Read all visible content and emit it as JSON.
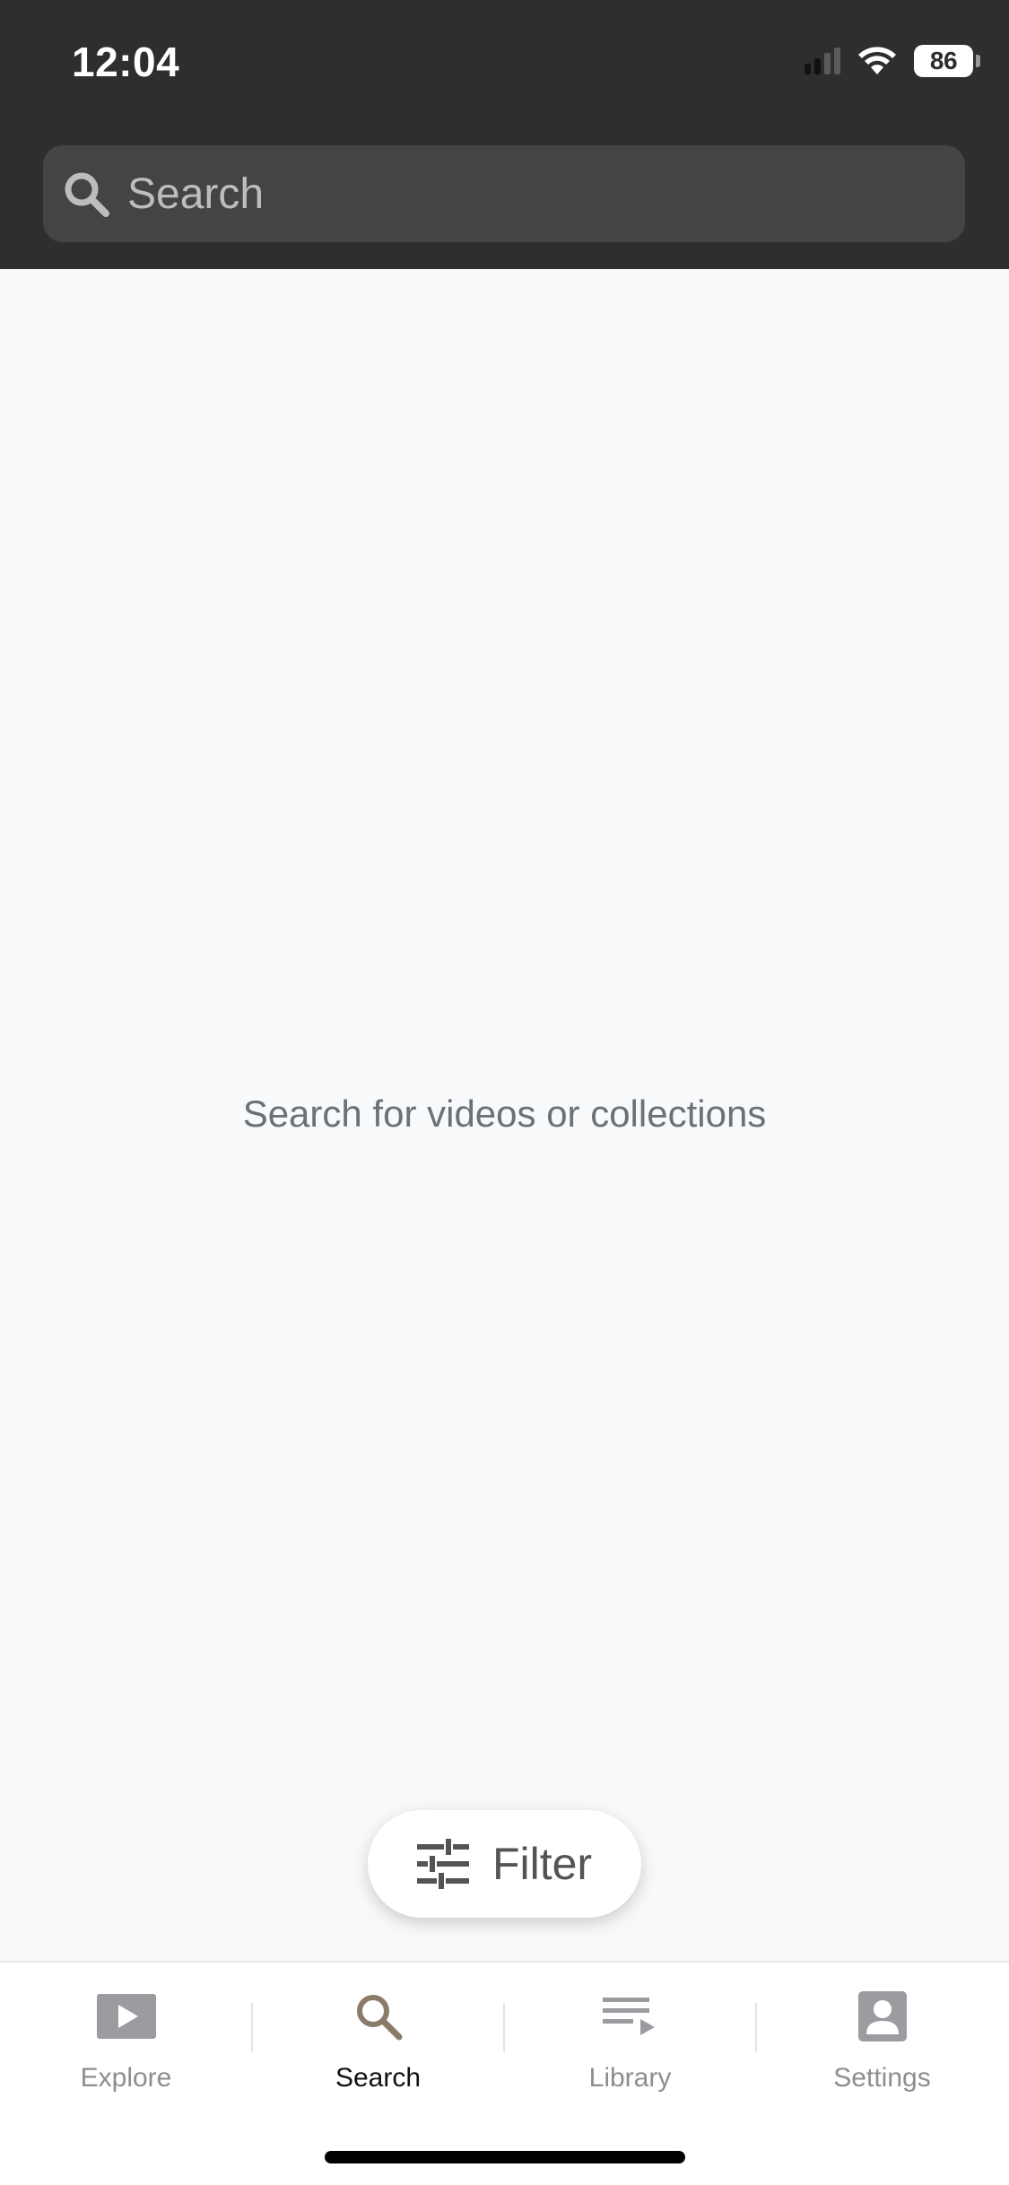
{
  "status_bar": {
    "time": "12:04",
    "battery": "86"
  },
  "search": {
    "placeholder": "Search",
    "value": ""
  },
  "empty_state": {
    "message": "Search for videos or collections"
  },
  "filter": {
    "label": "Filter",
    "icon": "sliders-icon"
  },
  "tabbar": {
    "items": [
      {
        "label": "Explore",
        "icon": "play-icon",
        "active": false
      },
      {
        "label": "Search",
        "icon": "search-icon",
        "active": true
      },
      {
        "label": "Library",
        "icon": "playlist-icon",
        "active": false
      },
      {
        "label": "Settings",
        "icon": "person-icon",
        "active": false
      }
    ]
  },
  "colors": {
    "header_bg": "#2f2e2f",
    "search_bg": "#444444",
    "page_bg": "#f8f9fb",
    "active_tab_icon": "#8a7a6a",
    "inactive_tab": "#8e8e8e"
  }
}
